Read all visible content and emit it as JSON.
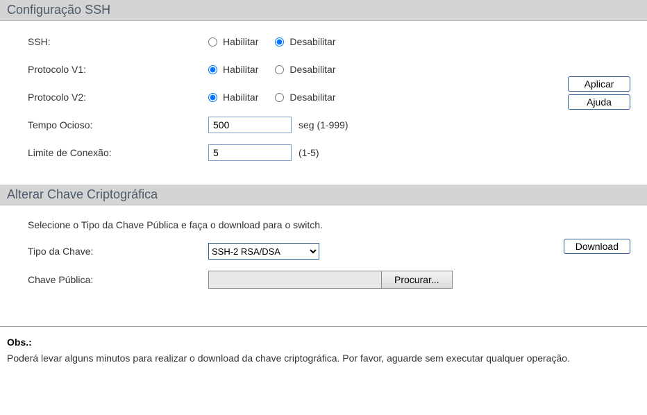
{
  "ssh_config": {
    "header": "Configuração SSH",
    "rows": {
      "ssh": {
        "label": "SSH:",
        "enable": "Habilitar",
        "disable": "Desabilitar"
      },
      "v1": {
        "label": "Protocolo V1:",
        "enable": "Habilitar",
        "disable": "Desabilitar"
      },
      "v2": {
        "label": "Protocolo V2:",
        "enable": "Habilitar",
        "disable": "Desabilitar"
      },
      "idle": {
        "label": "Tempo Ocioso:",
        "value": "500",
        "suffix": "seg (1-999)"
      },
      "limit": {
        "label": "Limite de Conexão:",
        "value": "5",
        "suffix": "(1-5)"
      }
    },
    "buttons": {
      "apply": "Aplicar",
      "help": "Ajuda"
    }
  },
  "key_section": {
    "header": "Alterar Chave Criptográfica",
    "instruction": "Selecione o Tipo da Chave Pública e faça o download para o switch.",
    "key_type_label": "Tipo da Chave:",
    "key_type_value": "SSH-2 RSA/DSA",
    "public_key_label": "Chave Pública:",
    "browse": "Procurar...",
    "download": "Download"
  },
  "note": {
    "title": "Obs.:",
    "text": "Poderá levar alguns minutos para realizar o download da chave criptográfica. Por favor, aguarde sem executar qualquer operação."
  }
}
